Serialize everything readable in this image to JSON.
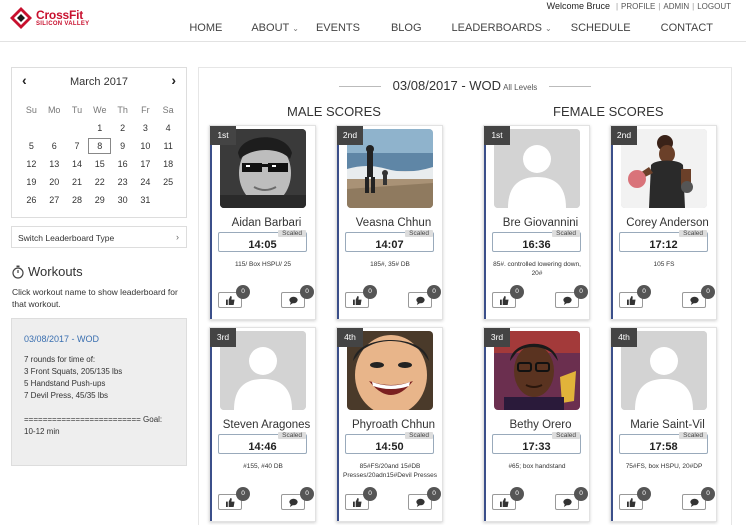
{
  "header": {
    "logo_name": "CrossFit",
    "logo_sub": "SILICON VALLEY",
    "welcome": "Welcome Bruce",
    "top_links": [
      "PROFILE",
      "ADMIN",
      "LOGOUT"
    ],
    "nav": [
      {
        "label": "HOME",
        "dropdown": false
      },
      {
        "label": "ABOUT",
        "dropdown": true
      },
      {
        "label": "EVENTS",
        "dropdown": false
      },
      {
        "label": "BLOG",
        "dropdown": false
      },
      {
        "label": "LEADERBOARDS",
        "dropdown": true
      },
      {
        "label": "SCHEDULE",
        "dropdown": false
      },
      {
        "label": "CONTACT",
        "dropdown": false
      }
    ]
  },
  "calendar": {
    "month": "March 2017",
    "prev_icon": "‹",
    "next_icon": "›",
    "dow": [
      "Su",
      "Mo",
      "Tu",
      "We",
      "Th",
      "Fr",
      "Sa"
    ],
    "weeks": [
      [
        "",
        "",
        "",
        "1",
        "2",
        "3",
        "4"
      ],
      [
        "5",
        "6",
        "7",
        "8",
        "9",
        "10",
        "11"
      ],
      [
        "12",
        "13",
        "14",
        "15",
        "16",
        "17",
        "18"
      ],
      [
        "19",
        "20",
        "21",
        "22",
        "23",
        "24",
        "25"
      ],
      [
        "26",
        "27",
        "28",
        "29",
        "30",
        "31",
        ""
      ]
    ],
    "selected": "8"
  },
  "switch_label": "Switch Leaderboard Type",
  "workouts": {
    "title": "Workouts",
    "description": "Click workout name to show leaderboard for that workout.",
    "wod_link": "03/08/2017 - WOD",
    "lines": [
      "7 rounds for time of:",
      "3 Front Squats, 205/135 lbs",
      "5 Handstand Push-ups",
      "7 Devil Press, 45/35 lbs",
      "",
      "========================= Goal:",
      "10-12 min"
    ]
  },
  "main": {
    "title": "03/08/2017 - WOD",
    "subtitle": "All Levels",
    "male_heading": "MALE SCORES",
    "female_heading": "FEMALE SCORES"
  },
  "cards": [
    {
      "rank": "1st",
      "name": "Aidan Barbari",
      "scaled": "Scaled",
      "score": "14:05",
      "note": "115/ Box HSPU/ 25",
      "likes": "0",
      "comments": "0",
      "photo": "sunglasses"
    },
    {
      "rank": "2nd",
      "name": "Veasna Chhun",
      "scaled": "Scaled",
      "score": "14:07",
      "note": "185#, 35# DB",
      "likes": "0",
      "comments": "0",
      "photo": "beach"
    },
    {
      "rank": "1st",
      "name": "Bre Giovannini",
      "scaled": "Scaled",
      "score": "16:36",
      "note": "85#. controlled lowering down, 20#",
      "likes": "0",
      "comments": "0",
      "photo": "placeholder"
    },
    {
      "rank": "2nd",
      "name": "Corey Anderson",
      "scaled": "Scaled",
      "score": "17:12",
      "note": "105 FS",
      "likes": "0",
      "comments": "0",
      "photo": "kettlebell"
    },
    {
      "rank": "3rd",
      "name": "Steven Aragones",
      "scaled": "Scaled",
      "score": "14:46",
      "note": "#155, #40 DB",
      "likes": "0",
      "comments": "0",
      "photo": "placeholder"
    },
    {
      "rank": "4th",
      "name": "Phyroath Chhun",
      "scaled": "Scaled",
      "score": "14:50",
      "note": "85#FS/20and 15#DB Presses/20adn15#Devil Presses",
      "likes": "0",
      "comments": "0",
      "photo": "smile"
    },
    {
      "rank": "3rd",
      "name": "Bethy Orero",
      "scaled": "Scaled",
      "score": "17:33",
      "note": "#65; box handstand",
      "likes": "0",
      "comments": "0",
      "photo": "glasses"
    },
    {
      "rank": "4th",
      "name": "Marie Saint-Vil",
      "scaled": "Scaled",
      "score": "17:58",
      "note": "75#FS, box HSPU, 20#DP",
      "likes": "0",
      "comments": "0",
      "photo": "placeholder"
    }
  ]
}
